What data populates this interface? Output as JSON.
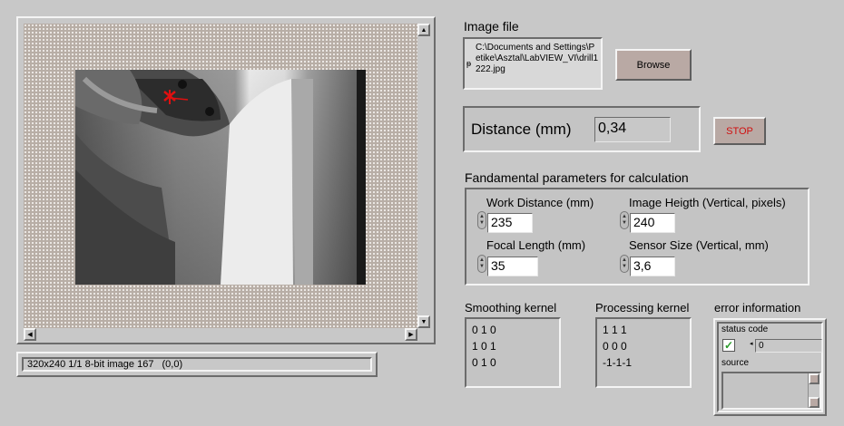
{
  "image_display": {
    "status": "320x240 1/1 8-bit image 167",
    "coords": "(0,0)"
  },
  "image_file": {
    "label": "Image file",
    "path": "C:\\Documents and Settings\\Petike\\Asztal\\LabVIEW_VI\\drill1222.jpg",
    "browse_label": "Browse"
  },
  "distance": {
    "label": "Distance (mm)",
    "value": "0,34"
  },
  "stop_label": "STOP",
  "params": {
    "title": "Fandamental parameters for calculation",
    "work_distance": {
      "label": "Work Distance (mm)",
      "value": "235"
    },
    "image_height": {
      "label": "Image Heigth (Vertical, pixels)",
      "value": "240"
    },
    "focal_length": {
      "label": "Focal Length (mm)",
      "value": "35"
    },
    "sensor_size": {
      "label": "Sensor Size (Vertical, mm)",
      "value": "3,6"
    }
  },
  "smoothing": {
    "label": "Smoothing kernel",
    "rows": [
      "0 1 0",
      "1 0 1",
      "0 1 0"
    ]
  },
  "processing": {
    "label": "Processing kernel",
    "rows": [
      "1 1 1",
      "0 0 0",
      "-1-1-1"
    ]
  },
  "error_info": {
    "title": "error information",
    "status_label": "status code",
    "code_value": "0",
    "source_label": "source",
    "status_color": "#2a9a2a"
  }
}
